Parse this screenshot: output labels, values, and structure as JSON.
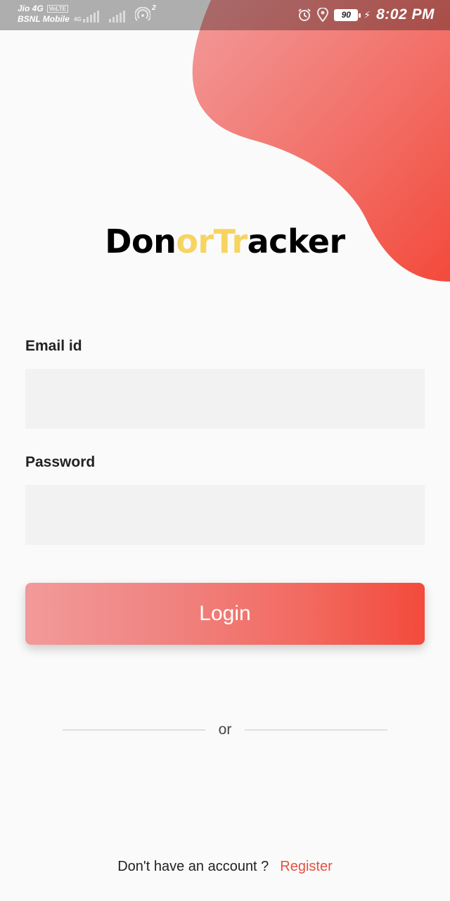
{
  "status_bar": {
    "carrier_line1": "Jio 4G",
    "volte_badge": "VoLTE",
    "carrier_line2": "BSNL Mobile",
    "network_type": "4G",
    "hotspot_count": "2",
    "battery_level": "90",
    "time": "8:02 PM",
    "icons": [
      "alarm-icon",
      "location-icon",
      "battery-icon",
      "charging-icon",
      "signal-icon",
      "hotspot-icon"
    ]
  },
  "logo": {
    "part1": "Don",
    "part2": "orTr",
    "part3": "acker"
  },
  "form": {
    "email_label": "Email id",
    "email_value": "",
    "email_placeholder": "",
    "password_label": "Password",
    "password_value": "",
    "password_placeholder": "",
    "login_label": "Login"
  },
  "divider": {
    "text": "or"
  },
  "footer": {
    "prompt": "Don't have an account ?",
    "register_label": "Register"
  },
  "colors": {
    "accent_gradient_start": "#f29a9a",
    "accent_gradient_end": "#f34a3b",
    "logo_accent": "#f7d460",
    "register_link": "#e35140",
    "background": "#fafafa",
    "input_background": "#f2f2f2"
  }
}
